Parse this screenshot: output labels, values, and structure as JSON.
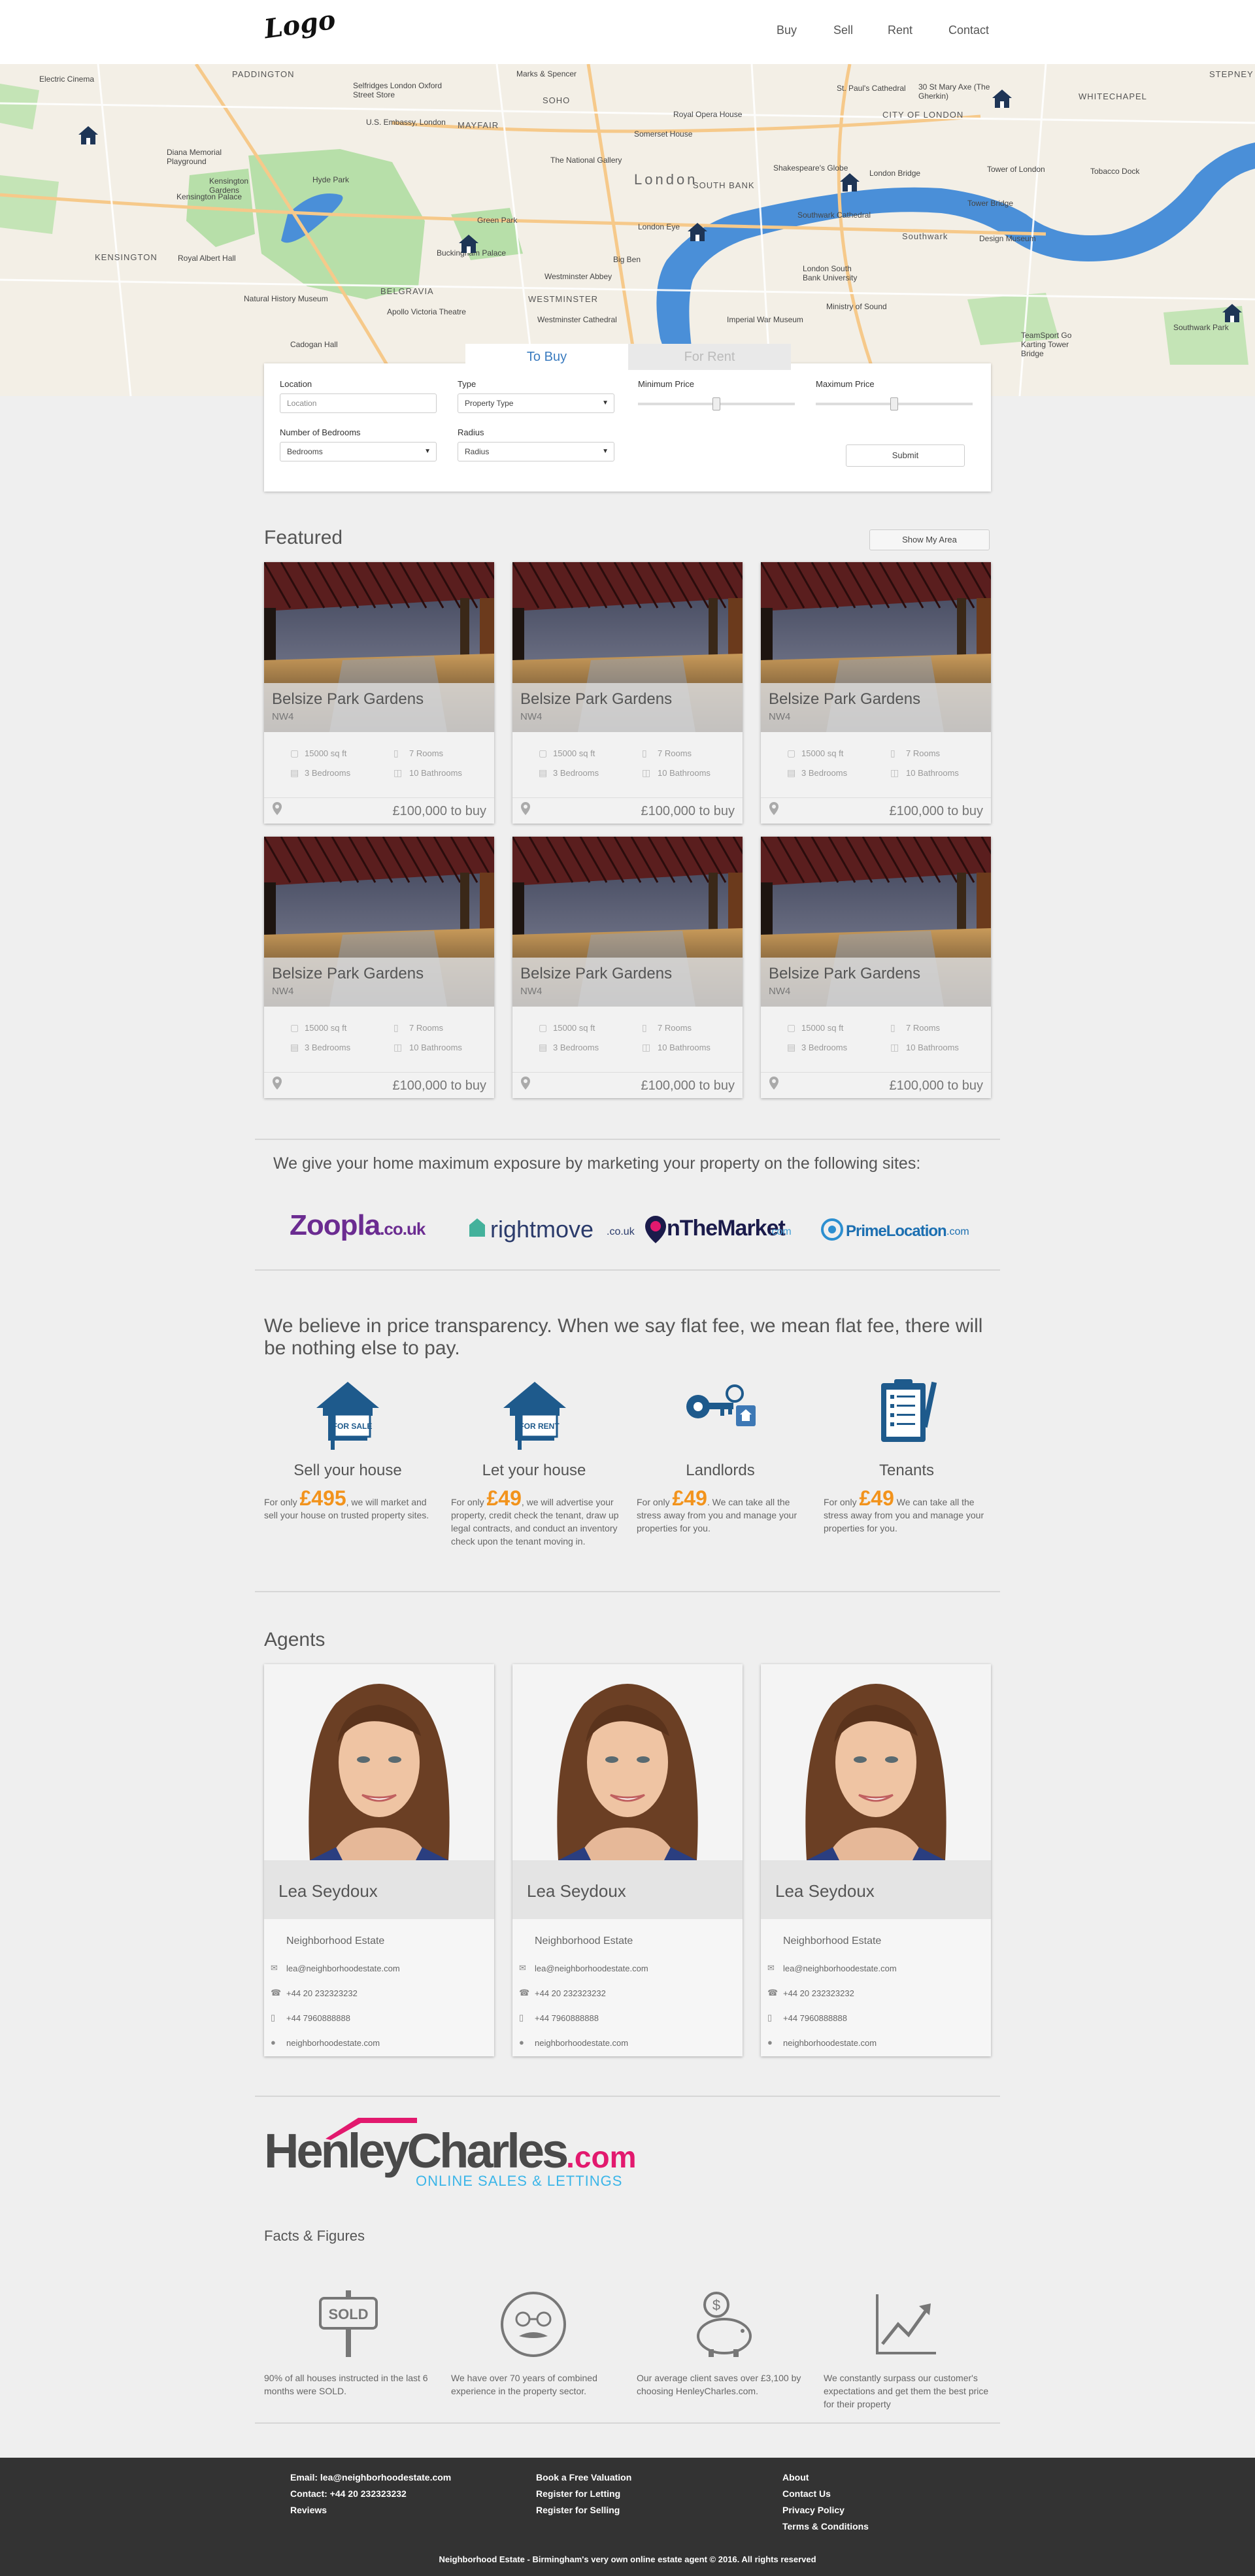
{
  "header": {
    "logo": "Logo",
    "nav": [
      "Buy",
      "Sell",
      "Rent",
      "Contact"
    ]
  },
  "map": {
    "labels": [
      "PADDINGTON",
      "Marks & Spencer",
      "Selfridges London Oxford Street Store",
      "SOHO",
      "St. Paul's Cathedral",
      "30 St Mary Axe (The Gherkin)",
      "STEPNEY",
      "Electric Cinema",
      "U.S. Embassy, London",
      "MAYFAIR",
      "Royal Opera House",
      "CITY OF LONDON",
      "WHITECHAPEL",
      "Somerset House",
      "Diana Memorial Playground",
      "Kensington Gardens",
      "Hyde Park",
      "The National Gallery",
      "Shakespeare's Globe",
      "London Bridge",
      "Tower of London",
      "Tobacco Dock",
      "Kensington Palace",
      "Tower Bridge",
      "Green Park",
      "London Eye",
      "SOUTH BANK",
      "Southwark Cathedral",
      "Buckingham Palace",
      "Big Ben",
      "Design Museum",
      "KENSINGTON",
      "Royal Albert Hall",
      "Westminster Abbey",
      "London South Bank University",
      "Natural History Museum",
      "BELGRAVIA",
      "WESTMINSTER",
      "Ministry of Sound",
      "Apollo Victoria Theatre",
      "Westminster Cathedral",
      "Imperial War Museum",
      "Southwark Park",
      "Cadogan Hall",
      "TeamSport Go Karting Tower Bridge",
      "London",
      "Southwark"
    ]
  },
  "search": {
    "tab_buy": "To Buy",
    "tab_rent": "For Rent",
    "location_label": "Location",
    "location_placeholder": "Location",
    "type_label": "Type",
    "type_value": "Property Type",
    "min_price_label": "Minimum Price",
    "max_price_label": "Maximum Price",
    "bedrooms_label": "Number of Bedrooms",
    "bedrooms_value": "Bedrooms",
    "radius_label": "Radius",
    "radius_value": "Radius",
    "submit": "Submit"
  },
  "featured": {
    "title": "Featured",
    "show_area": "Show My Area",
    "listings": [
      {
        "title": "Belsize Park Gardens",
        "area": "NW4",
        "sqft": "15000 sq ft",
        "rooms": "7 Rooms",
        "bedrooms": "3 Bedrooms",
        "bathrooms": "10 Bathrooms",
        "price": "£100,000 to buy"
      },
      {
        "title": "Belsize Park Gardens",
        "area": "NW4",
        "sqft": "15000 sq ft",
        "rooms": "7 Rooms",
        "bedrooms": "3 Bedrooms",
        "bathrooms": "10 Bathrooms",
        "price": "£100,000 to buy"
      },
      {
        "title": "Belsize Park Gardens",
        "area": "NW4",
        "sqft": "15000 sq ft",
        "rooms": "7 Rooms",
        "bedrooms": "3 Bedrooms",
        "bathrooms": "10 Bathrooms",
        "price": "£100,000 to buy"
      },
      {
        "title": "Belsize Park Gardens",
        "area": "NW4",
        "sqft": "15000 sq ft",
        "rooms": "7 Rooms",
        "bedrooms": "3 Bedrooms",
        "bathrooms": "10 Bathrooms",
        "price": "£100,000 to buy"
      },
      {
        "title": "Belsize Park Gardens",
        "area": "NW4",
        "sqft": "15000 sq ft",
        "rooms": "7 Rooms",
        "bedrooms": "3 Bedrooms",
        "bathrooms": "10 Bathrooms",
        "price": "£100,000 to buy"
      },
      {
        "title": "Belsize Park Gardens",
        "area": "NW4",
        "sqft": "15000 sq ft",
        "rooms": "7 Rooms",
        "bedrooms": "3 Bedrooms",
        "bathrooms": "10 Bathrooms",
        "price": "£100,000 to buy"
      }
    ]
  },
  "partners": {
    "text": "We give your home maximum exposure by marketing your property on the following sites:",
    "zoopla": "Zoopla",
    "zoopla_tld": ".co.uk",
    "rightmove": "rightmove",
    "rightmove_tld": ".co.uk",
    "otm": "nTheMarket",
    "otm_tld": ".com",
    "prime": "PrimeLocation",
    "prime_tld": ".com"
  },
  "services": {
    "headline": "We believe in price transparency. When we say flat fee, we mean flat fee, there will be nothing else to pay.",
    "items": [
      {
        "title": "Sell your house",
        "pre": "For only ",
        "amount": "£495",
        "post": ", we will market and sell your house on trusted property sites.",
        "sign": "FOR SALE"
      },
      {
        "title": "Let your house",
        "pre": "For only ",
        "amount": "£49",
        "post": ", we will advertise your property, credit check the tenant, draw up legal contracts, and conduct an inventory check upon the tenant moving in.",
        "sign": "FOR RENT"
      },
      {
        "title": "Landlords",
        "pre": "For only ",
        "amount": "£49",
        "post": ". We can take all the stress away from you and manage your properties for you."
      },
      {
        "title": "Tenants",
        "pre": "For only ",
        "amount": "£49",
        "post": " We can take all the stress away from you and manage your properties for you."
      }
    ]
  },
  "agents": {
    "title": "Agents",
    "list": [
      {
        "name": "Lea Seydoux",
        "company": "Neighborhood Estate",
        "email": "lea@neighborhoodestate.com",
        "phone": "+44 20 232323232",
        "mobile": "+44 7960888888",
        "web": "neighborhoodestate.com"
      },
      {
        "name": "Lea Seydoux",
        "company": "Neighborhood Estate",
        "email": "lea@neighborhoodestate.com",
        "phone": "+44 20 232323232",
        "mobile": "+44 7960888888",
        "web": "neighborhoodestate.com"
      },
      {
        "name": "Lea Seydoux",
        "company": "Neighborhood Estate",
        "email": "lea@neighborhoodestate.com",
        "phone": "+44 20 232323232",
        "mobile": "+44 7960888888",
        "web": "neighborhoodestate.com"
      }
    ]
  },
  "brand": {
    "name_a": "Henley",
    "name_b": "Charles",
    "tld": ".com",
    "tagline": "ONLINE SALES & LETTINGS"
  },
  "facts": {
    "title": "Facts & Figures",
    "sold_sign": "SOLD",
    "items": [
      "90% of all houses instructed in the last 6 months were SOLD.",
      "We have over 70 years of combined experience in the property sector.",
      "Our average client saves over £3,100 by choosing HenleyCharles.com.",
      "We constantly surpass our customer's expectations and get them the best price for their property"
    ]
  },
  "footer": {
    "col1": [
      "Email: lea@neighborhoodestate.com",
      "Contact: +44 20 232323232",
      "Reviews"
    ],
    "col2": [
      "Book a Free Valuation",
      "Register for Letting",
      "Register for Selling"
    ],
    "col3": [
      "About",
      "Contact Us",
      "Privacy Policy",
      "Terms & Conditions"
    ],
    "copyright": "Neighborhood Estate - Birmingham's very own online estate agent © 2016. All rights reserved"
  },
  "colors": {
    "accent_orange": "#f2931c",
    "brand_pink": "#e2196e",
    "brand_blue": "#3bb5e8",
    "river_blue": "#4a8fd8",
    "icon_blue": "#1e5a8c"
  }
}
